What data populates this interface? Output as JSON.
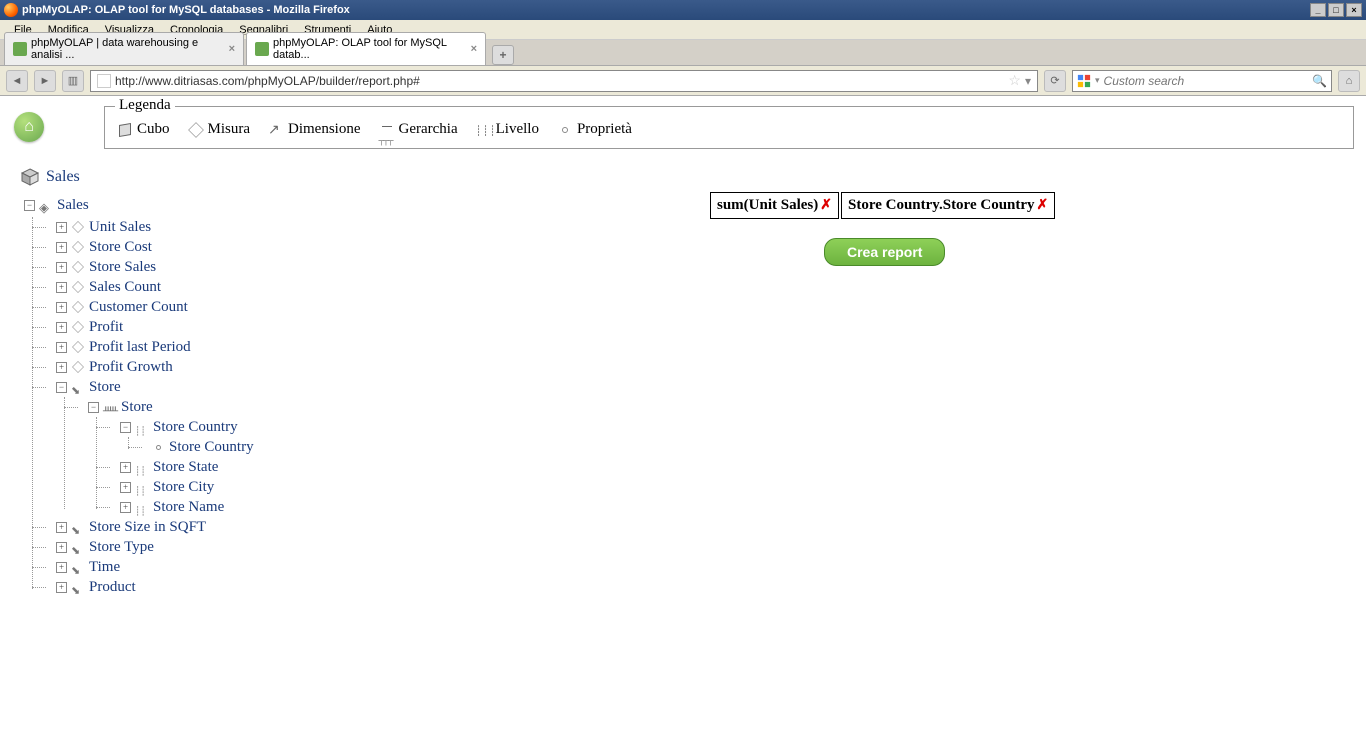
{
  "window": {
    "title": "phpMyOLAP: OLAP tool for MySQL databases - Mozilla Firefox"
  },
  "menu": {
    "file": "File",
    "edit": "Modifica",
    "view": "Visualizza",
    "history": "Cronologia",
    "bookmarks": "Segnalibri",
    "tools": "Strumenti",
    "help": "Aiuto"
  },
  "tabs": {
    "tab1": "phpMyOLAP | data warehousing e analisi ...",
    "tab2": "phpMyOLAP: OLAP tool for MySQL datab..."
  },
  "url": "http://www.ditriasas.com/phpMyOLAP/builder/report.php#",
  "search": {
    "placeholder": "Custom search"
  },
  "legend": {
    "title": "Legenda",
    "cube": "Cubo",
    "measure": "Misura",
    "dimension": "Dimensione",
    "hierarchy": "Gerarchia",
    "level": "Livello",
    "property": "Proprietà"
  },
  "cube": {
    "name": "Sales"
  },
  "selected": {
    "measure": "sum(Unit Sales)",
    "dimension": "Store Country.Store Country"
  },
  "button": {
    "create": "Crea report"
  },
  "tree": {
    "root": "Sales",
    "measures": {
      "unit_sales": "Unit Sales",
      "store_cost": "Store Cost",
      "store_sales": "Store Sales",
      "sales_count": "Sales Count",
      "customer_count": "Customer Count",
      "profit": "Profit",
      "profit_last": "Profit last Period",
      "profit_growth": "Profit Growth"
    },
    "dim_store": "Store",
    "hier_store": "Store",
    "levels": {
      "country": "Store Country",
      "country_prop": "Store Country",
      "state": "Store State",
      "city": "Store City",
      "name": "Store Name"
    },
    "dim_store_size": "Store Size in SQFT",
    "dim_store_type": "Store Type",
    "dim_time": "Time",
    "dim_product": "Product"
  }
}
